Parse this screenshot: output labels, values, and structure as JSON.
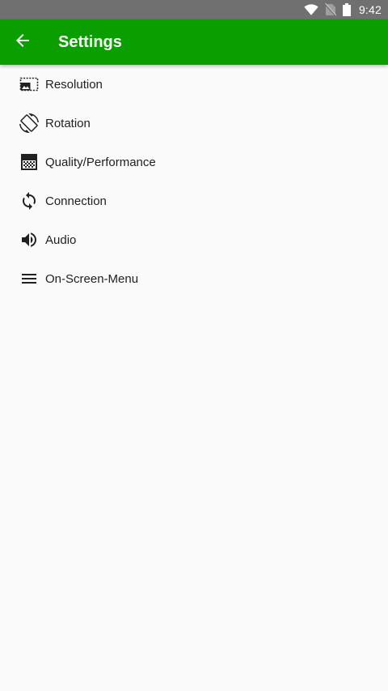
{
  "status_bar": {
    "time": "9:42",
    "icons": [
      "wifi-icon",
      "no-sim-icon",
      "battery-icon"
    ]
  },
  "app_bar": {
    "title": "Settings",
    "back_icon": "arrow-back-icon",
    "background_color": "#0a9e00"
  },
  "settings": {
    "items": [
      {
        "label": "Resolution",
        "icon": "resolution-icon"
      },
      {
        "label": "Rotation",
        "icon": "screen-rotation-icon"
      },
      {
        "label": "Quality/Performance",
        "icon": "quality-icon"
      },
      {
        "label": "Connection",
        "icon": "sync-icon"
      },
      {
        "label": "Audio",
        "icon": "volume-icon"
      },
      {
        "label": "On-Screen-Menu",
        "icon": "menu-icon"
      }
    ]
  }
}
